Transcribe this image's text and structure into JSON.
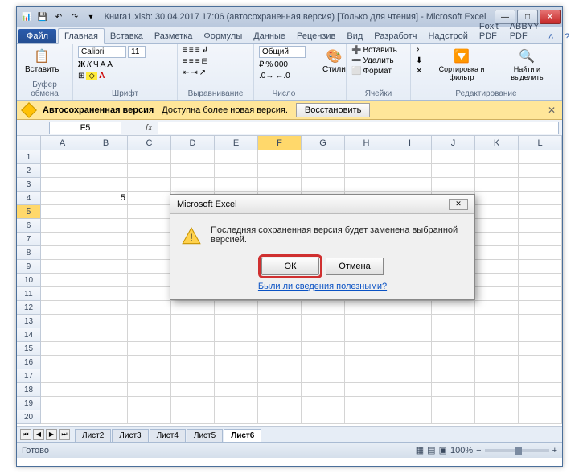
{
  "titlebar": {
    "title": "Книга1.xlsb: 30.04.2017 17:06 (автосохраненная версия)   [Только для чтения]  -  Microsoft Excel"
  },
  "ribbon": {
    "file": "Файл",
    "tabs": [
      "Главная",
      "Вставка",
      "Разметка",
      "Формулы",
      "Данные",
      "Рецензив",
      "Вид",
      "Разработч",
      "Надстрой",
      "Foxit PDF",
      "ABBYY PDF"
    ],
    "groups": {
      "clipboard": {
        "paste": "Вставить",
        "label": "Буфер обмена"
      },
      "font": {
        "name": "Calibri",
        "size": "11",
        "label": "Шрифт"
      },
      "alignment": {
        "label": "Выравнивание"
      },
      "number": {
        "format": "Общий",
        "label": "Число"
      },
      "styles": {
        "btn": "Стили",
        "label": ""
      },
      "cells": {
        "insert": "Вставить",
        "delete": "Удалить",
        "format": "Формат",
        "label": "Ячейки"
      },
      "editing": {
        "sort": "Сортировка и фильтр",
        "find": "Найти и выделить",
        "label": "Редактирование"
      }
    }
  },
  "infobar": {
    "title": "Автосохраненная версия",
    "msg": "Доступна более новая версия.",
    "btn": "Восстановить"
  },
  "namebox": "F5",
  "columns": [
    "A",
    "B",
    "C",
    "D",
    "E",
    "F",
    "G",
    "H",
    "I",
    "J",
    "K",
    "L"
  ],
  "rows_count": 20,
  "active_cell": {
    "row": 5,
    "col": "F"
  },
  "cell_values": {
    "B4": "5"
  },
  "sheets": [
    "Лист2",
    "Лист3",
    "Лист4",
    "Лист5",
    "Лист6"
  ],
  "active_sheet": "Лист6",
  "statusbar": {
    "ready": "Готово",
    "zoom": "100%"
  },
  "dialog": {
    "title": "Microsoft Excel",
    "message": "Последняя сохраненная версия будет заменена выбранной версией.",
    "ok": "ОК",
    "cancel": "Отмена",
    "link": "Были ли сведения полезными?"
  }
}
